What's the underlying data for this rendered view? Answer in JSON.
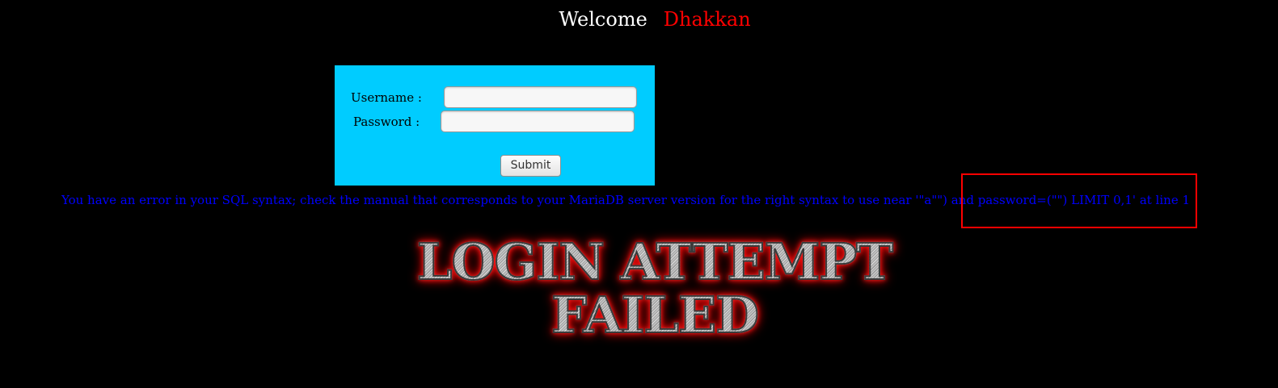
{
  "header": {
    "welcome": "Welcome",
    "username": "Dhakkan"
  },
  "login_form": {
    "username_label": "Username :",
    "password_label": "Password :",
    "username_value": "",
    "password_value": "",
    "submit_label": "Submit",
    "background_color": "#00ccff"
  },
  "error": {
    "message": "You have an error in your SQL syntax; check the manual that corresponds to your MariaDB server version for the right syntax to use near '\"a\"\") and password=(\"\") LIMIT 0,1' at line 1",
    "color": "#0000ff",
    "highlight_color": "#ff0000"
  },
  "banner": {
    "line1": "LOGIN ATTEMPT",
    "line2": "FAILED"
  }
}
